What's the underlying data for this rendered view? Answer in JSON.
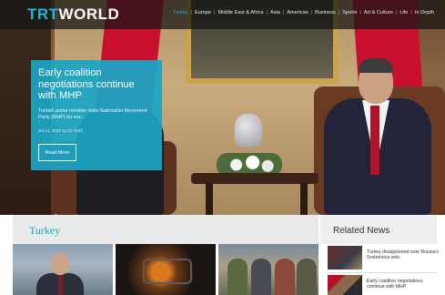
{
  "brand": {
    "logo_part1": "TRT",
    "logo_part2": "WORLD",
    "accent": "#1ab8d8"
  },
  "nav": {
    "items": [
      {
        "label": "Turkey",
        "active": true
      },
      {
        "label": "Europe"
      },
      {
        "label": "Middle East & Africa"
      },
      {
        "label": "Asia"
      },
      {
        "label": "Americas"
      },
      {
        "label": "Business"
      },
      {
        "label": "Sports"
      },
      {
        "label": "Art & Culture"
      },
      {
        "label": "Life"
      },
      {
        "label": "In Depth"
      }
    ],
    "separator": "|"
  },
  "hero": {
    "title": "Early coalition negotiations continue with MHP",
    "summary": "Turkish prime minister visits Nationalist Movement Party (MHP) for ear...",
    "date": "Jul 14, 2015 11:03 GMT",
    "button_label": "Read More",
    "card_color": "#1ca5c4"
  },
  "section": {
    "title": "Turkey"
  },
  "related": {
    "title": "Related News",
    "items": [
      {
        "text": "Turkey disappointed over Russia's Srebrenica veto"
      },
      {
        "text": "Early coalition negotiations continue with MHP"
      }
    ]
  }
}
